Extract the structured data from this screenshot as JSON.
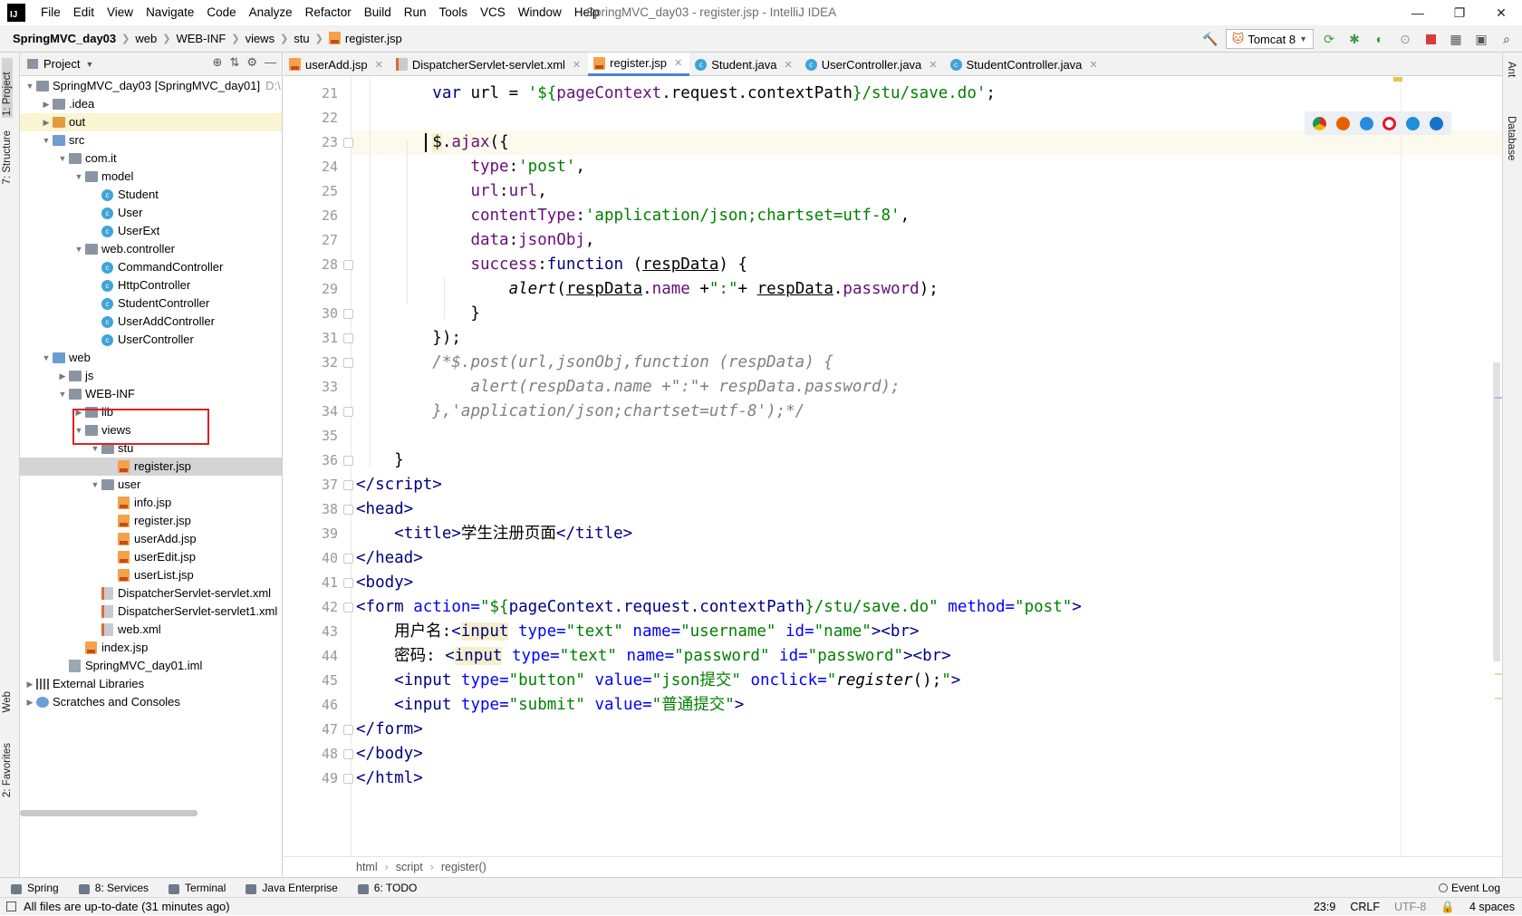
{
  "window": {
    "title": "SpringMVC_day03 - register.jsp - IntelliJ IDEA",
    "logo": "IJ",
    "menu": [
      "File",
      "Edit",
      "View",
      "Navigate",
      "Code",
      "Analyze",
      "Refactor",
      "Build",
      "Run",
      "Tools",
      "VCS",
      "Window",
      "Help"
    ]
  },
  "breadcrumb": [
    "SpringMVC_day03",
    "web",
    "WEB-INF",
    "views",
    "stu",
    "register.jsp"
  ],
  "toolbar": {
    "run_config": "Tomcat 8"
  },
  "left_stripe": {
    "project": "1: Project",
    "structure": "7: Structure",
    "web": "Web",
    "favorites": "2: Favorites"
  },
  "right_stripe": {
    "ant": "Ant",
    "database": "Database"
  },
  "project_panel": {
    "title": "Project",
    "tree": [
      {
        "label": "SpringMVC_day03 [SpringMVC_day01]",
        "suffix": "D:\\",
        "indent": 0,
        "arrow": "▼",
        "icon": "folder-module"
      },
      {
        "label": ".idea",
        "indent": 1,
        "arrow": "▶",
        "icon": "folder"
      },
      {
        "label": "out",
        "indent": 1,
        "arrow": "▶",
        "icon": "folder-orange",
        "highlight": true
      },
      {
        "label": "src",
        "indent": 1,
        "arrow": "▼",
        "icon": "folder-blue"
      },
      {
        "label": "com.it",
        "indent": 2,
        "arrow": "▼",
        "icon": "folder"
      },
      {
        "label": "model",
        "indent": 3,
        "arrow": "▼",
        "icon": "folder"
      },
      {
        "label": "Student",
        "indent": 4,
        "arrow": "",
        "icon": "class"
      },
      {
        "label": "User",
        "indent": 4,
        "arrow": "",
        "icon": "class"
      },
      {
        "label": "UserExt",
        "indent": 4,
        "arrow": "",
        "icon": "class"
      },
      {
        "label": "web.controller",
        "indent": 3,
        "arrow": "▼",
        "icon": "folder"
      },
      {
        "label": "CommandController",
        "indent": 4,
        "arrow": "",
        "icon": "class"
      },
      {
        "label": "HttpController",
        "indent": 4,
        "arrow": "",
        "icon": "class"
      },
      {
        "label": "StudentController",
        "indent": 4,
        "arrow": "",
        "icon": "class"
      },
      {
        "label": "UserAddController",
        "indent": 4,
        "arrow": "",
        "icon": "class"
      },
      {
        "label": "UserController",
        "indent": 4,
        "arrow": "",
        "icon": "class"
      },
      {
        "label": "web",
        "indent": 1,
        "arrow": "▼",
        "icon": "folder-blue"
      },
      {
        "label": "js",
        "indent": 2,
        "arrow": "▶",
        "icon": "folder"
      },
      {
        "label": "WEB-INF",
        "indent": 2,
        "arrow": "▼",
        "icon": "folder"
      },
      {
        "label": "lib",
        "indent": 3,
        "arrow": "▶",
        "icon": "folder"
      },
      {
        "label": "views",
        "indent": 3,
        "arrow": "▼",
        "icon": "folder"
      },
      {
        "label": "stu",
        "indent": 4,
        "arrow": "▼",
        "icon": "folder"
      },
      {
        "label": "register.jsp",
        "indent": 5,
        "arrow": "",
        "icon": "jsp",
        "selected": true
      },
      {
        "label": "user",
        "indent": 4,
        "arrow": "▼",
        "icon": "folder"
      },
      {
        "label": "info.jsp",
        "indent": 5,
        "arrow": "",
        "icon": "jsp"
      },
      {
        "label": "register.jsp",
        "indent": 5,
        "arrow": "",
        "icon": "jsp"
      },
      {
        "label": "userAdd.jsp",
        "indent": 5,
        "arrow": "",
        "icon": "jsp"
      },
      {
        "label": "userEdit.jsp",
        "indent": 5,
        "arrow": "",
        "icon": "jsp"
      },
      {
        "label": "userList.jsp",
        "indent": 5,
        "arrow": "",
        "icon": "jsp"
      },
      {
        "label": "DispatcherServlet-servlet.xml",
        "indent": 4,
        "arrow": "",
        "icon": "xml"
      },
      {
        "label": "DispatcherServlet-servlet1.xml",
        "indent": 4,
        "arrow": "",
        "icon": "xml"
      },
      {
        "label": "web.xml",
        "indent": 4,
        "arrow": "",
        "icon": "xml"
      },
      {
        "label": "index.jsp",
        "indent": 3,
        "arrow": "",
        "icon": "jsp"
      },
      {
        "label": "SpringMVC_day01.iml",
        "indent": 2,
        "arrow": "",
        "icon": "iml"
      },
      {
        "label": "External Libraries",
        "indent": 0,
        "arrow": "▶",
        "icon": "lib"
      },
      {
        "label": "Scratches and Consoles",
        "indent": 0,
        "arrow": "▶",
        "icon": "scratch"
      }
    ]
  },
  "tabs": [
    {
      "label": "userAdd.jsp",
      "icon": "jsp",
      "active": false
    },
    {
      "label": "DispatcherServlet-servlet.xml",
      "icon": "xml",
      "active": false
    },
    {
      "label": "register.jsp",
      "icon": "jsp",
      "active": true
    },
    {
      "label": "Student.java",
      "icon": "class",
      "active": false
    },
    {
      "label": "UserController.java",
      "icon": "class",
      "active": false
    },
    {
      "label": "StudentController.java",
      "icon": "class",
      "active": false
    }
  ],
  "editor": {
    "current_line": "23",
    "lines": [
      {
        "n": "21",
        "html": "        <span class=\"kw\">var</span> url = <span class=\"st\">'${</span><span class=\"pr\">pageContext</span>.request.contextPath<span class=\"st\">}/stu/save.do'</span>;",
        "fold": false
      },
      {
        "n": "22",
        "html": "",
        "fold": false
      },
      {
        "n": "23",
        "html": "        <span class=\"hl\">$</span>.<span class=\"pr\">ajax</span>({",
        "fold": true
      },
      {
        "n": "24",
        "html": "            <span class=\"pr\">type</span>:<span class=\"st\">'post'</span>,",
        "fold": false
      },
      {
        "n": "25",
        "html": "            <span class=\"pr\">url</span>:<span class=\"pr\">url</span>,",
        "fold": false
      },
      {
        "n": "26",
        "html": "            <span class=\"pr\">contentType</span>:<span class=\"st\">'application/json;chartset=utf-8'</span>,",
        "fold": false
      },
      {
        "n": "27",
        "html": "            <span class=\"pr\">data</span>:<span class=\"pr\">jsonObj</span>,",
        "fold": false
      },
      {
        "n": "28",
        "html": "            <span class=\"pr\">success</span>:<span class=\"kw\">function</span> (<span class=\"ul\">respData</span>) {",
        "fold": true
      },
      {
        "n": "29",
        "html": "                <span class=\"it\">alert</span>(<span class=\"ul\">respData</span>.<span class=\"pr\">name</span> +<span class=\"st\">\":\"</span>+ <span class=\"ul\">respData</span>.<span class=\"pr\">password</span>);",
        "fold": false
      },
      {
        "n": "30",
        "html": "            }",
        "fold": true
      },
      {
        "n": "31",
        "html": "        });",
        "fold": true
      },
      {
        "n": "32",
        "html": "        <span class=\"cm\">/*$.post(url,jsonObj,function (respData) {</span>",
        "fold": true
      },
      {
        "n": "33",
        "html": "            <span class=\"cm\">alert(respData.name +\":\"+ respData.password);</span>",
        "fold": false
      },
      {
        "n": "34",
        "html": "        <span class=\"cm\">},'application/json;chartset=utf-8');*/</span>",
        "fold": true
      },
      {
        "n": "35",
        "html": "",
        "fold": false
      },
      {
        "n": "36",
        "html": "    }",
        "fold": true
      },
      {
        "n": "37",
        "html": "<span class=\"tg\">&lt;/script&gt;</span>",
        "fold": true
      },
      {
        "n": "38",
        "html": "<span class=\"tg\">&lt;head&gt;</span>",
        "fold": true
      },
      {
        "n": "39",
        "html": "    <span class=\"tg\">&lt;title&gt;</span>学生注册页面<span class=\"tg\">&lt;/title&gt;</span>",
        "fold": false
      },
      {
        "n": "40",
        "html": "<span class=\"tg\">&lt;/head&gt;</span>",
        "fold": true
      },
      {
        "n": "41",
        "html": "<span class=\"tg\">&lt;body&gt;</span>",
        "fold": true
      },
      {
        "n": "42",
        "html": "<span class=\"tg\">&lt;form </span><span class=\"at\">action=</span><span class=\"av\">\"${</span><span class=\"tg\">pageContext.request.contextPath</span><span class=\"av\">}/stu/save.do\"</span> <span class=\"at\">method=</span><span class=\"av\">\"post\"</span><span class=\"tg\">&gt;</span>",
        "fold": true
      },
      {
        "n": "43",
        "html": "    用户名:<span class=\"tg\">&lt;<span class=\"hl\">input</span> </span><span class=\"at\">type=</span><span class=\"av\">\"text\"</span> <span class=\"at\">name=</span><span class=\"av\">\"username\"</span> <span class=\"at\">id=</span><span class=\"av\">\"name\"</span><span class=\"tg\">&gt;&lt;br&gt;</span>",
        "fold": false
      },
      {
        "n": "44",
        "html": "    密码: <span class=\"tg\">&lt;<span class=\"hl\">input</span> </span><span class=\"at\">type=</span><span class=\"av\">\"text\"</span> <span class=\"at\">name=</span><span class=\"av\">\"password\"</span> <span class=\"at\">id=</span><span class=\"av\">\"password\"</span><span class=\"tg\">&gt;&lt;br&gt;</span>",
        "fold": false
      },
      {
        "n": "45",
        "html": "    <span class=\"tg\">&lt;input </span><span class=\"at\">type=</span><span class=\"av\">\"button\"</span> <span class=\"at\">value=</span><span class=\"av\">\"json提交\"</span> <span class=\"at\">onclick=</span><span class=\"av\">\"<span class=\"it\" style=\"color:#000\">register</span><span style=\"color:#000\">();</span>\"</span><span class=\"tg\">&gt;</span>",
        "fold": false
      },
      {
        "n": "46",
        "html": "    <span class=\"tg\">&lt;input </span><span class=\"at\">type=</span><span class=\"av\">\"submit\"</span> <span class=\"at\">value=</span><span class=\"av\">\"普通提交\"</span><span class=\"tg\">&gt;</span>",
        "fold": false
      },
      {
        "n": "47",
        "html": "<span class=\"tg\">&lt;/form&gt;</span>",
        "fold": true
      },
      {
        "n": "48",
        "html": "<span class=\"tg\">&lt;/body&gt;</span>",
        "fold": true
      },
      {
        "n": "49",
        "html": "<span class=\"tg\">&lt;/html&gt;</span>",
        "fold": true
      }
    ]
  },
  "code_breadcrumb": [
    "html",
    "script",
    "register()"
  ],
  "bottom_tools": [
    "Spring",
    "8: Services",
    "Terminal",
    "Java Enterprise",
    "6: TODO"
  ],
  "event_log": "Event Log",
  "status": {
    "message": "All files are up-to-date (31 minutes ago)",
    "position": "23:9",
    "line_sep": "CRLF",
    "encoding": "UTF-8",
    "indent": "4 spaces"
  }
}
